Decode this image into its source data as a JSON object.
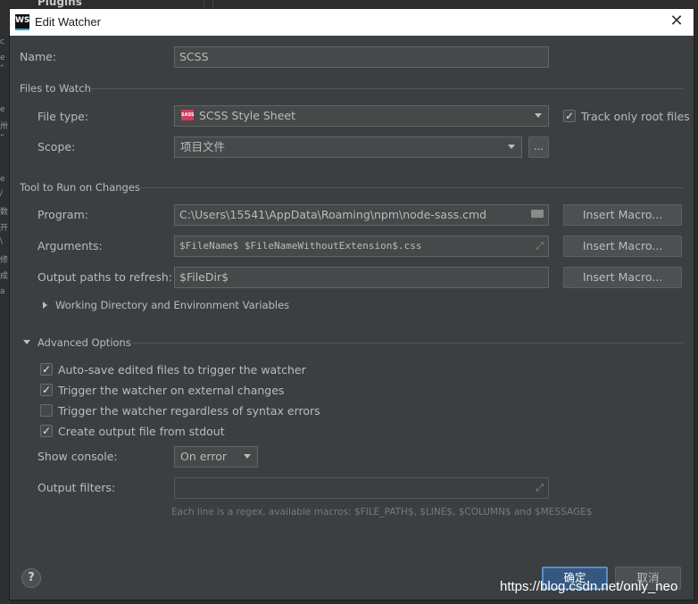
{
  "background": {
    "plugins_label": "Plugins",
    "ghost_chars": [
      "c",
      "e",
      "”",
      "e",
      "卅",
      "”",
      "e",
      "/",
      "数",
      "开",
      "\\",
      "修",
      "成",
      "a"
    ]
  },
  "dialog": {
    "title": "Edit Watcher",
    "close_symbol": "✕"
  },
  "name": {
    "label": "Name:",
    "value": "SCSS"
  },
  "files_to_watch": {
    "section_label": "Files to Watch",
    "file_type_label": "File type:",
    "file_type_value": "SCSS Style Sheet",
    "file_type_icon": "sass-file-icon",
    "track_root_label": "Track only root files",
    "track_root_checked": true,
    "scope_label": "Scope:",
    "scope_value": "项目文件",
    "scope_browse": "..."
  },
  "tool": {
    "section_label": "Tool to Run on Changes",
    "program_label": "Program:",
    "program_value": "C:\\Users\\15541\\AppData\\Roaming\\npm\\node-sass.cmd",
    "arguments_label": "Arguments:",
    "arguments_value": "$FileName$ $FileNameWithoutExtension$.css",
    "output_label": "Output paths to refresh:",
    "output_value": "$FileDir$",
    "insert_macro": "Insert Macro...",
    "working_dir_label": "Working Directory and Environment Variables"
  },
  "advanced": {
    "section_label": "Advanced Options",
    "options": [
      {
        "label": "Auto-save edited files to trigger the watcher",
        "checked": true
      },
      {
        "label": "Trigger the watcher on external changes",
        "checked": true
      },
      {
        "label": "Trigger the watcher regardless of syntax errors",
        "checked": false
      },
      {
        "label": "Create output file from stdout",
        "checked": true
      }
    ],
    "show_console_label": "Show console:",
    "show_console_value": "On error",
    "output_filters_label": "Output filters:",
    "output_filters_value": "",
    "hint": "Each line is a regex, available macros: $FILE_PATH$, $LINE$, $COLUMN$ and $MESSAGE$"
  },
  "footer": {
    "help": "?",
    "ok": "确定",
    "cancel": "取消",
    "watermark": "https://blog.csdn.net/only_neo"
  },
  "colors": {
    "dialog_bg": "#3c3f41",
    "field_bg": "#45494a",
    "primary_button": "#365880",
    "text": "#bbbbbb"
  }
}
